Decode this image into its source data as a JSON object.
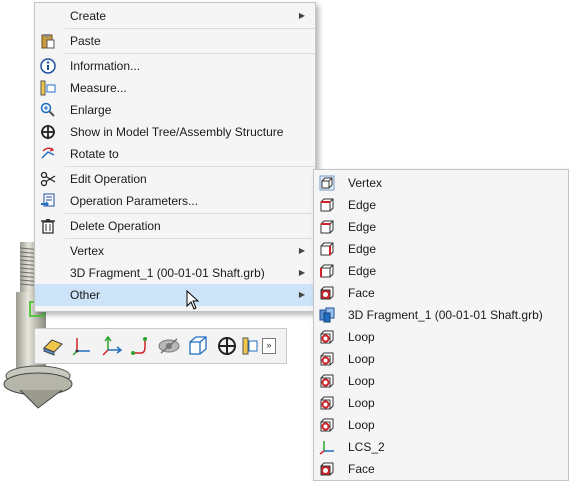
{
  "main_menu": {
    "items": [
      {
        "label": "Create"
      },
      {
        "label": "Paste"
      },
      {
        "label": "Information..."
      },
      {
        "label": "Measure..."
      },
      {
        "label": "Enlarge"
      },
      {
        "label": "Show in Model Tree/Assembly Structure"
      },
      {
        "label": "Rotate to"
      },
      {
        "label": "Edit Operation"
      },
      {
        "label": "Operation Parameters..."
      },
      {
        "label": "Delete Operation"
      },
      {
        "label": "Vertex"
      },
      {
        "label": "3D Fragment_1 (00-01-01 Shaft.grb)"
      },
      {
        "label": "Other"
      }
    ]
  },
  "sub_menu": {
    "items": [
      {
        "label": "Vertex",
        "icon": "vertex-icon"
      },
      {
        "label": "Edge",
        "icon": "edge-icon"
      },
      {
        "label": "Edge",
        "icon": "edge-icon"
      },
      {
        "label": "Edge",
        "icon": "edge-icon"
      },
      {
        "label": "Edge",
        "icon": "edge-icon"
      },
      {
        "label": "Face",
        "icon": "face-icon"
      },
      {
        "label": "3D Fragment_1 (00-01-01 Shaft.grb)",
        "icon": "fragment-icon"
      },
      {
        "label": "Loop",
        "icon": "loop-icon"
      },
      {
        "label": "Loop",
        "icon": "loop-icon"
      },
      {
        "label": "Loop",
        "icon": "loop-icon"
      },
      {
        "label": "Loop",
        "icon": "loop-icon"
      },
      {
        "label": "Loop",
        "icon": "loop-icon"
      },
      {
        "label": "LCS_2",
        "icon": "lcs-icon"
      },
      {
        "label": "Face",
        "icon": "face-icon"
      }
    ]
  },
  "toolbar": {
    "more_label": "»",
    "buttons": [
      "solid-eraser-icon",
      "lcs-axes-icon",
      "axes-icon",
      "path-icon",
      "hide-icon",
      "box-icon",
      "crosshair-icon",
      "measure-icon"
    ]
  },
  "colors": {
    "highlight": "#cde3f7",
    "menu_bg": "#f5f5f5",
    "accent_red": "#d3232a",
    "accent_blue": "#1f6fc1",
    "model_green": "#5cc947"
  }
}
